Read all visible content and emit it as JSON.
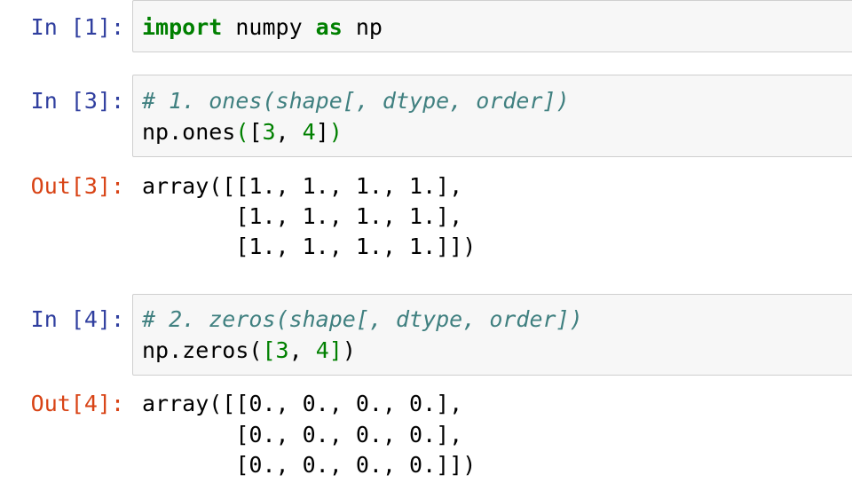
{
  "cells": [
    {
      "prompt": "In [1]:",
      "code": [
        [
          {
            "t": "import",
            "cls": "kw"
          },
          {
            "t": " numpy ",
            "cls": ""
          },
          {
            "t": "as",
            "cls": "kw"
          },
          {
            "t": " np",
            "cls": ""
          }
        ]
      ]
    },
    {
      "prompt": "In [3]:",
      "code": [
        [
          {
            "t": "# 1. ones(shape[, dtype, order])",
            "cls": "cm"
          }
        ],
        [
          {
            "t": "np.ones",
            "cls": ""
          },
          {
            "t": "(",
            "cls": "br"
          },
          {
            "t": "[",
            "cls": ""
          },
          {
            "t": "3",
            "cls": "num"
          },
          {
            "t": ", ",
            "cls": ""
          },
          {
            "t": "4",
            "cls": "num"
          },
          {
            "t": "]",
            "cls": ""
          },
          {
            "t": ")",
            "cls": "br"
          }
        ]
      ],
      "out_prompt": "Out[3]:",
      "output": [
        "array([[1., 1., 1., 1.],",
        "       [1., 1., 1., 1.],",
        "       [1., 1., 1., 1.]])"
      ]
    },
    {
      "prompt": "In [4]:",
      "code": [
        [
          {
            "t": "# 2. zeros(shape[, dtype, order])",
            "cls": "cm"
          }
        ],
        [
          {
            "t": "np.zeros(",
            "cls": ""
          },
          {
            "t": "[",
            "cls": "br"
          },
          {
            "t": "3",
            "cls": "num"
          },
          {
            "t": ", ",
            "cls": ""
          },
          {
            "t": "4",
            "cls": "num"
          },
          {
            "t": "]",
            "cls": "br"
          },
          {
            "t": ")",
            "cls": ""
          }
        ]
      ],
      "out_prompt": "Out[4]:",
      "output": [
        "array([[0., 0., 0., 0.],",
        "       [0., 0., 0., 0.],",
        "       [0., 0., 0., 0.]])"
      ]
    }
  ],
  "colors": {
    "in_prompt": "#303f9f",
    "out_prompt": "#d84315",
    "keyword": "#008000",
    "comment": "#408080",
    "number": "#008000",
    "cell_background": "#f7f7f7",
    "cell_border": "#cfcfcf"
  }
}
